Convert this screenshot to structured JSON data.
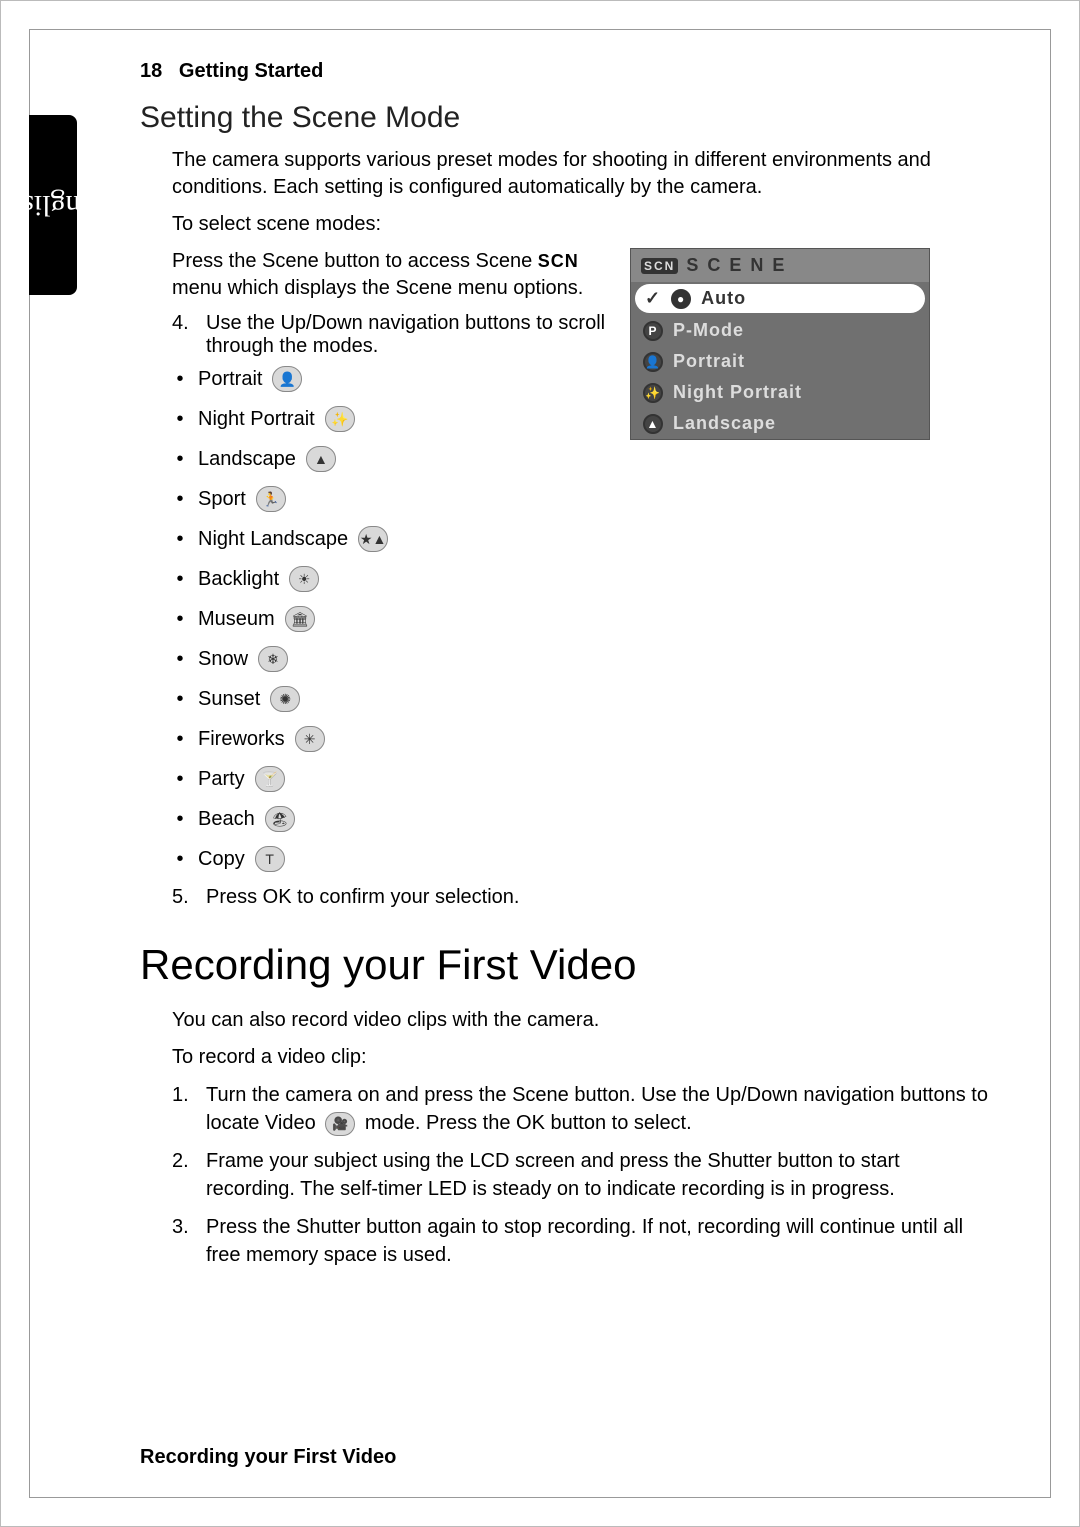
{
  "language_tab": "English",
  "header": {
    "page_num": "18",
    "section": "Getting Started"
  },
  "h2": "Setting the Scene Mode",
  "intro": "The camera supports various preset modes for shooting in different environments and conditions. Each setting is configured automatically by the camera.",
  "select_lead": "To select scene modes:",
  "press_scene_1": "Press the Scene button to access Scene ",
  "press_scene_2": "menu which displays the Scene menu options.",
  "scn_label": "SCN",
  "step4_num": "4.",
  "step4": "Use the Up/Down navigation buttons to scroll through the modes.",
  "modes": [
    "Portrait",
    "Night Portrait",
    "Landscape",
    "Sport",
    "Night Landscape",
    "Backlight",
    "Museum",
    "Snow",
    "Sunset",
    "Fireworks",
    "Party",
    "Beach",
    "Copy"
  ],
  "mode_glyphs": [
    "👤",
    "✨",
    "▲",
    "🏃",
    "★▲",
    "☀",
    "🏛",
    "❄",
    "✺",
    "✳",
    "🍸",
    "🏖",
    "T"
  ],
  "step5_num": "5.",
  "step5": "Press OK to confirm your selection.",
  "scene_menu": {
    "title_badge": "SCN",
    "title": "S C E N E",
    "items": [
      {
        "label": "Auto",
        "selected": true,
        "glyph": "●"
      },
      {
        "label": "P-Mode",
        "selected": false,
        "glyph": "P"
      },
      {
        "label": "Portrait",
        "selected": false,
        "glyph": "👤"
      },
      {
        "label": "Night Portrait",
        "selected": false,
        "glyph": "✨"
      },
      {
        "label": "Landscape",
        "selected": false,
        "glyph": "▲"
      }
    ]
  },
  "h1": "Recording your First Video",
  "video_intro": "You can also record video clips with the camera.",
  "video_lead": "To record a video clip:",
  "video_steps": [
    {
      "num": "1.",
      "pre": "Turn the camera on and press the Scene button. Use the Up/Down navigation buttons to locate Video ",
      "post": " mode. Press the OK button to select.",
      "has_icon": true
    },
    {
      "num": "2.",
      "pre": "Frame your subject using the LCD screen and press the Shutter button to start recording. The self-timer LED is steady on to indicate recording is in progress.",
      "post": "",
      "has_icon": false
    },
    {
      "num": "3.",
      "pre": "Press the Shutter button again to stop recording. If not, recording will continue until all free memory space is used.",
      "post": "",
      "has_icon": false
    }
  ],
  "video_icon_glyph": "🎥",
  "footer": "Recording your First Video"
}
